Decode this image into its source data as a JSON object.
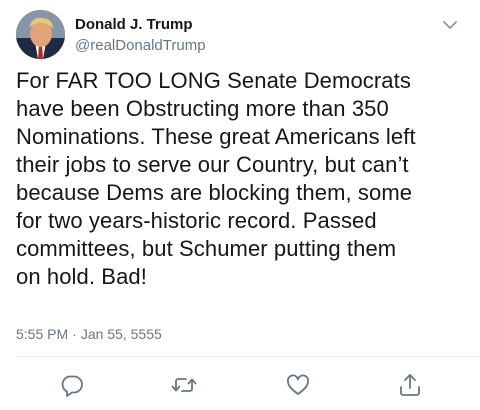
{
  "tweet": {
    "author": {
      "display_name": "Donald J. Trump",
      "handle": "@realDonaldTrump"
    },
    "text_lines": [
      "For FAR TOO LONG Senate Democrats",
      "have been Obstructing more than 350",
      "Nominations. These great Americans left",
      "their jobs to serve our Country, but can’t",
      "because Dems are blocking them, some",
      "for two years-historic record. Passed",
      "committees, but Schumer putting them",
      "on hold. Bad!"
    ],
    "time": "5:55 PM",
    "separator": "·",
    "date": "Jan 55, 5555"
  },
  "actions": [
    {
      "icon": "reply-icon"
    },
    {
      "icon": "retweet-icon"
    },
    {
      "icon": "like-icon"
    },
    {
      "icon": "share-icon"
    }
  ],
  "colors": {
    "text": "#14171a",
    "secondary": "#657786",
    "divider": "#e6ecf0",
    "icon": "#657786"
  }
}
